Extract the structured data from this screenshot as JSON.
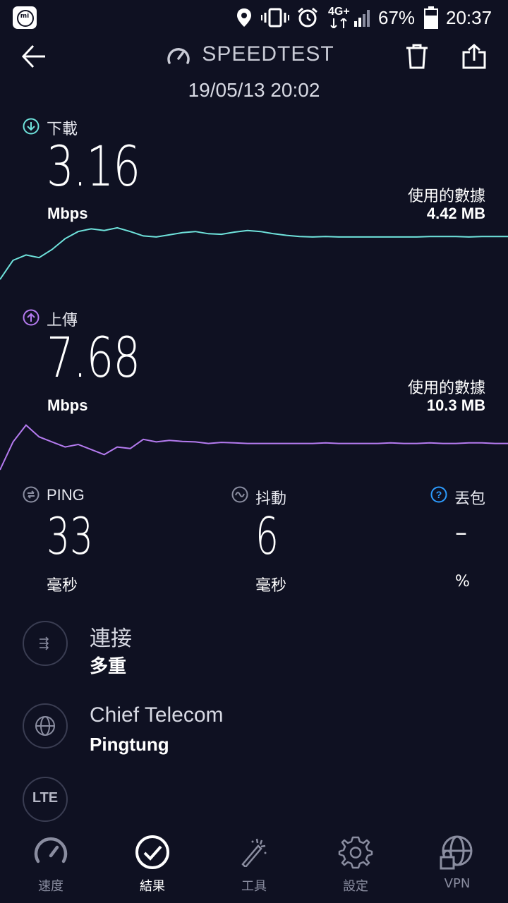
{
  "status_bar": {
    "badge": "mi",
    "battery": "67%",
    "time": "20:37",
    "network": "4G+"
  },
  "header": {
    "title": "SPEEDTEST",
    "date": "19/05/13 20:02"
  },
  "download": {
    "label": "下載",
    "value": "3.16",
    "unit": "Mbps",
    "data_used_label": "使用的數據",
    "data_used_value": "4.42 MB",
    "color": "#6fe3dc",
    "series": [
      0.0,
      0.35,
      0.45,
      0.4,
      0.55,
      0.75,
      0.88,
      0.93,
      0.9,
      0.95,
      0.88,
      0.8,
      0.78,
      0.82,
      0.86,
      0.88,
      0.84,
      0.83,
      0.87,
      0.9,
      0.88,
      0.84,
      0.81,
      0.79,
      0.78,
      0.79,
      0.78,
      0.78,
      0.78,
      0.78,
      0.78,
      0.78,
      0.78,
      0.79,
      0.79,
      0.79,
      0.78,
      0.79,
      0.79,
      0.79
    ]
  },
  "upload": {
    "label": "上傳",
    "value": "7.68",
    "unit": "Mbps",
    "data_used_label": "使用的數據",
    "data_used_value": "10.3 MB",
    "color": "#b57bf0",
    "series": [
      0.0,
      0.55,
      0.88,
      0.65,
      0.55,
      0.45,
      0.5,
      0.4,
      0.3,
      0.45,
      0.42,
      0.6,
      0.55,
      0.58,
      0.56,
      0.55,
      0.52,
      0.54,
      0.53,
      0.52,
      0.52,
      0.52,
      0.52,
      0.52,
      0.52,
      0.53,
      0.52,
      0.52,
      0.52,
      0.52,
      0.53,
      0.52,
      0.52,
      0.53,
      0.52,
      0.52,
      0.53,
      0.53,
      0.52,
      0.52
    ]
  },
  "metrics": {
    "ping": {
      "label": "PING",
      "value": "33",
      "unit": "毫秒"
    },
    "jitter": {
      "label": "抖動",
      "value": "6",
      "unit": "毫秒"
    },
    "loss": {
      "label": "丟包",
      "value": "–",
      "unit": "%"
    }
  },
  "info": {
    "connection": {
      "title": "連接",
      "sub": "多重"
    },
    "server": {
      "title": "Chief Telecom",
      "sub": "Pingtung"
    },
    "network_type": {
      "badge": "LTE"
    }
  },
  "nav": {
    "items": [
      {
        "label": "速度",
        "icon": "speedometer-icon",
        "active": false
      },
      {
        "label": "結果",
        "icon": "check-circle-icon",
        "active": true
      },
      {
        "label": "工具",
        "icon": "magic-wand-icon",
        "active": false
      },
      {
        "label": "設定",
        "icon": "gear-icon",
        "active": false
      },
      {
        "label": "VPN",
        "icon": "globe-lock-icon",
        "active": false
      }
    ]
  },
  "colors": {
    "background": "#0f1122",
    "nav_inactive": "#8a8da0",
    "nav_active": "#ffffff",
    "info_icon": "#2d9cff"
  }
}
